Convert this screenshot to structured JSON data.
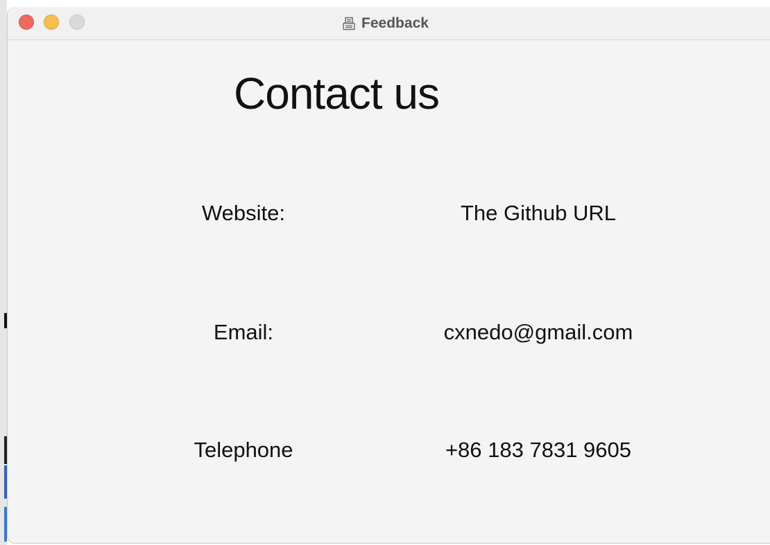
{
  "window": {
    "title": "Feedback",
    "title_icon": "fax-icon"
  },
  "page": {
    "heading": "Contact us"
  },
  "contacts": [
    {
      "label": "Website:",
      "value": "The Github URL"
    },
    {
      "label": "Email:",
      "value": "cxnedo@gmail.com"
    },
    {
      "label": "Telephone",
      "value": "+86 183 7831 9605"
    }
  ],
  "colors": {
    "close": "#ec6a5e",
    "minimize": "#f4bf4f",
    "zoom": "#d9d9d9",
    "window_bg": "#f4f4f4"
  }
}
